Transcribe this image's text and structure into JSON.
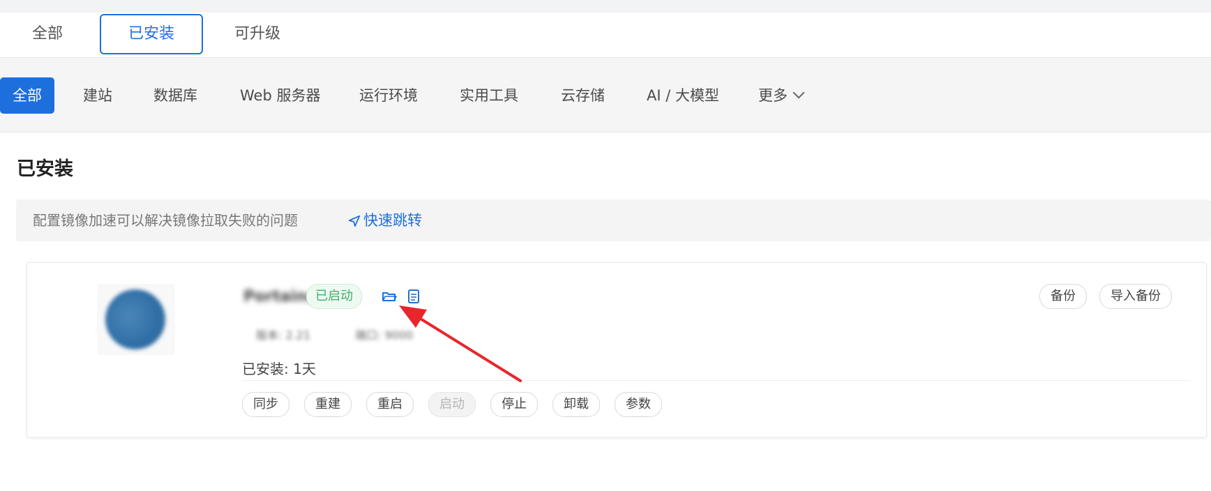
{
  "tabs": {
    "all": "全部",
    "installed": "已安装",
    "upgradable": "可升级"
  },
  "filters": [
    "全部",
    "建站",
    "数据库",
    "Web 服务器",
    "运行环境",
    "实用工具",
    "云存储",
    "AI / 大模型",
    "更多"
  ],
  "section_title": "已安装",
  "notice": {
    "text": "配置镜像加速可以解决镜像拉取失败的问题",
    "link": "快速跳转"
  },
  "app": {
    "name": "Portainer",
    "status": "已启动",
    "version": "版本: 2.21",
    "port": "端口: 9000",
    "installed_label": "已安装:",
    "installed_value": "1天",
    "actions": [
      "同步",
      "重建",
      "重启",
      "启动",
      "停止",
      "卸载",
      "参数"
    ],
    "right_actions": [
      "备份",
      "导入备份"
    ]
  },
  "colors": {
    "accent": "#1e6fde",
    "status_green": "#3fae6a",
    "annotation_arrow": "#e8262b"
  }
}
